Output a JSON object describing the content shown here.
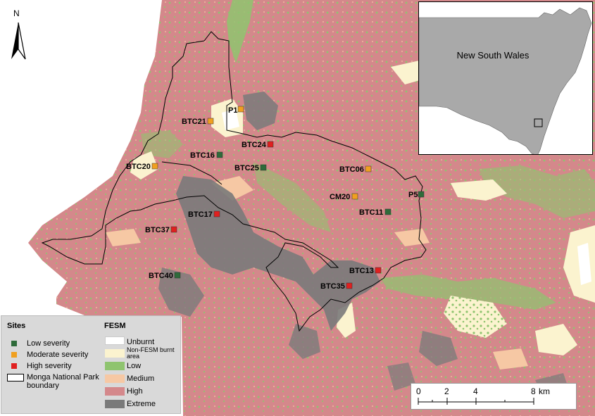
{
  "north_label": "N",
  "inset": {
    "label": "New South Wales"
  },
  "legend": {
    "sites_title": "Sites",
    "sites": [
      {
        "label": "Low severity",
        "color": "#2e6b3a"
      },
      {
        "label": "Moderate severity",
        "color": "#f0a020"
      },
      {
        "label": "High severity",
        "color": "#e02020"
      },
      {
        "label": "Monga National Park boundary",
        "line1": "Monga National Park",
        "line2": "boundary"
      }
    ],
    "fesm_title": "FESM",
    "fesm": [
      {
        "label": "Unburnt",
        "color": "#ffffff"
      },
      {
        "label": "Non-FESM burnt area",
        "line1": "Non-FESM burnt",
        "line2": "area",
        "color": "#fbf3cf"
      },
      {
        "label": "Low",
        "color": "#8fc46f"
      },
      {
        "label": "Medium",
        "color": "#f6c8a4"
      },
      {
        "label": "High",
        "color": "#d4888b"
      },
      {
        "label": "Extreme",
        "color": "#7a7a7a"
      }
    ]
  },
  "scale": {
    "ticks": [
      "0",
      "2",
      "4",
      "8"
    ],
    "unit": "km"
  },
  "sites": [
    {
      "id": "P1",
      "severity": "moderate"
    },
    {
      "id": "BTC21",
      "severity": "moderate"
    },
    {
      "id": "BTC24",
      "severity": "high"
    },
    {
      "id": "BTC16",
      "severity": "low"
    },
    {
      "id": "BTC20",
      "severity": "moderate"
    },
    {
      "id": "BTC25",
      "severity": "low"
    },
    {
      "id": "BTC06",
      "severity": "moderate"
    },
    {
      "id": "CM20",
      "severity": "moderate"
    },
    {
      "id": "P5",
      "severity": "low"
    },
    {
      "id": "BTC11",
      "severity": "low"
    },
    {
      "id": "BTC17",
      "severity": "high"
    },
    {
      "id": "BTC37",
      "severity": "high"
    },
    {
      "id": "BTC13",
      "severity": "high"
    },
    {
      "id": "BTC35",
      "severity": "high"
    },
    {
      "id": "BTC40",
      "severity": "low"
    }
  ],
  "colors": {
    "low": "#2e6b3a",
    "moderate": "#f0a020",
    "high": "#e02020"
  }
}
